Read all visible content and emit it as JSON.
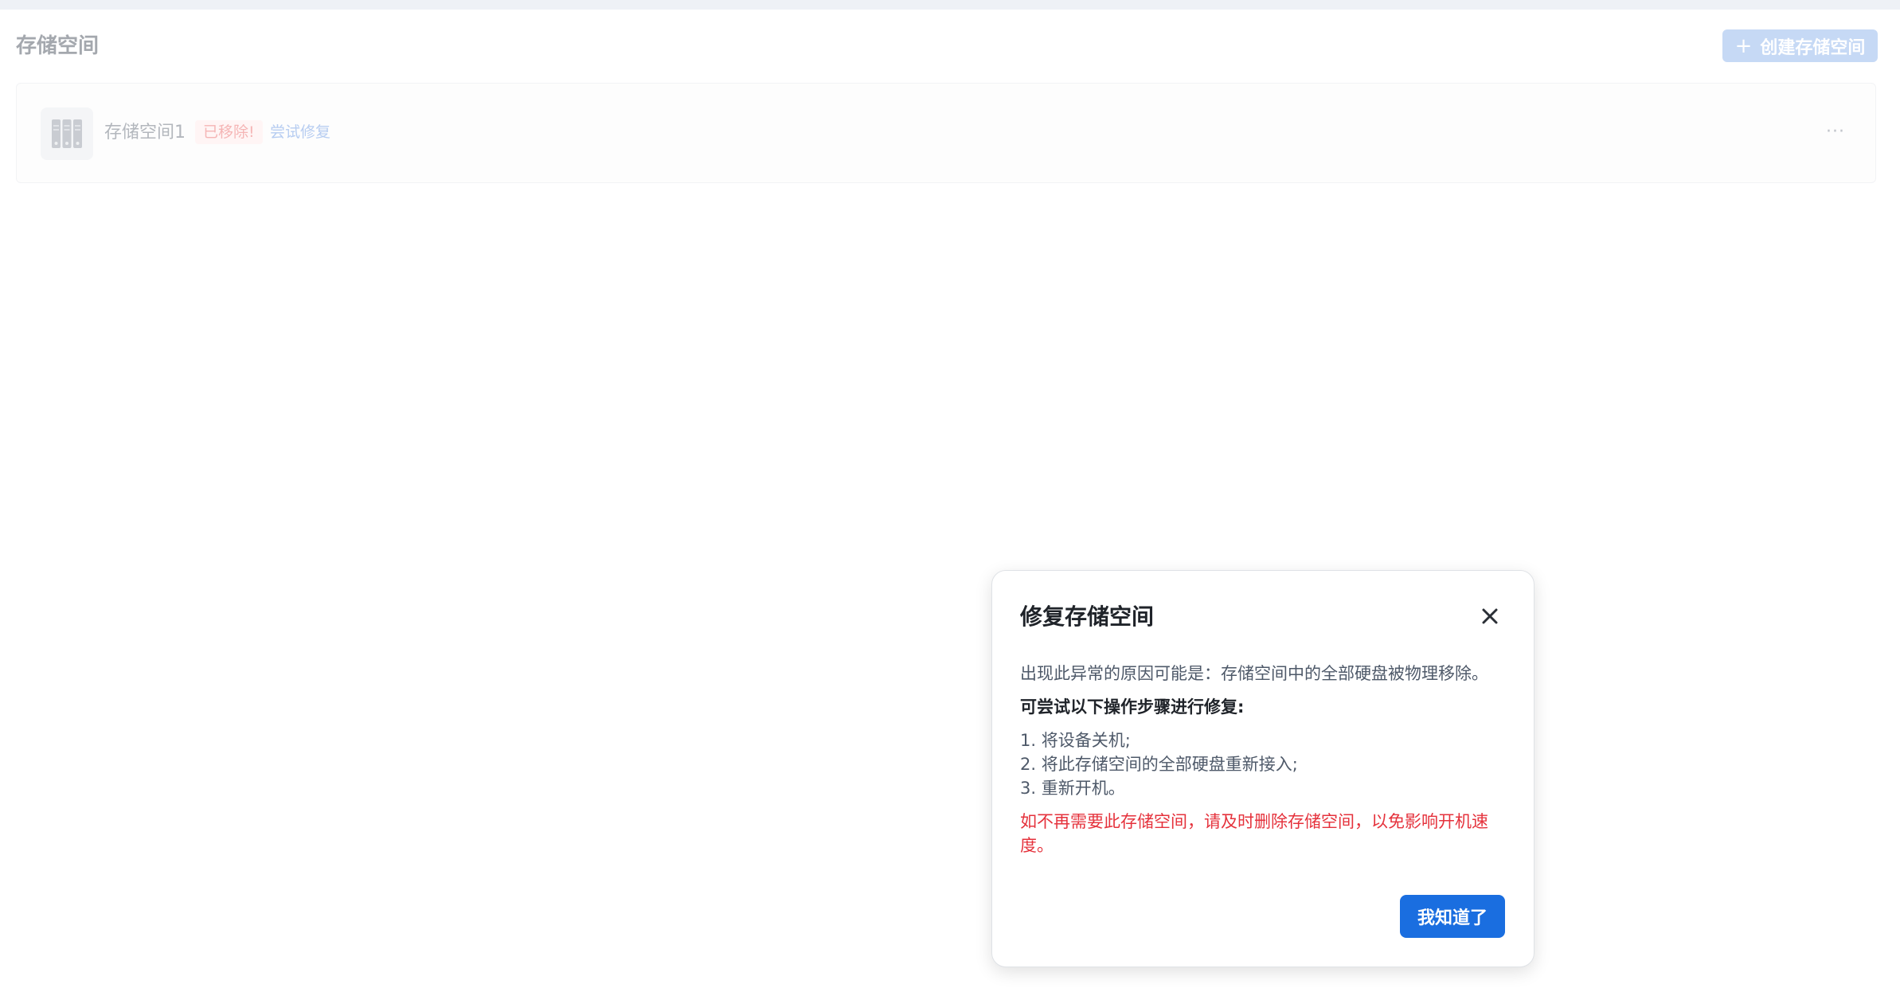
{
  "page": {
    "title": "存储空间",
    "create_button_label": "创建存储空间",
    "create_button_icon": "plus-icon"
  },
  "storage_list": [
    {
      "name": "存储空间1",
      "status_badge": "已移除!",
      "repair_link": "尝试修复",
      "icon": "storage-disk-icon",
      "more_icon": "more-horizontal-icon"
    }
  ],
  "modal": {
    "title": "修复存储空间",
    "close_icon": "close-icon",
    "reason": "出现此异常的原因可能是：存储空间中的全部硬盘被物理移除。",
    "steps_title": "可尝试以下操作步骤进行修复:",
    "steps": [
      "1. 将设备关机;",
      "2. 将此存储空间的全部硬盘重新接入;",
      "3. 重新开机。"
    ],
    "warning": "如不再需要此存储空间，请及时删除存储空间，以免影响开机速度。",
    "confirm_label": "我知道了"
  },
  "colors": {
    "accent": "#1a6ee0",
    "warning": "#e5323c",
    "text_primary": "#1f2329",
    "text_secondary": "#4e5969"
  }
}
